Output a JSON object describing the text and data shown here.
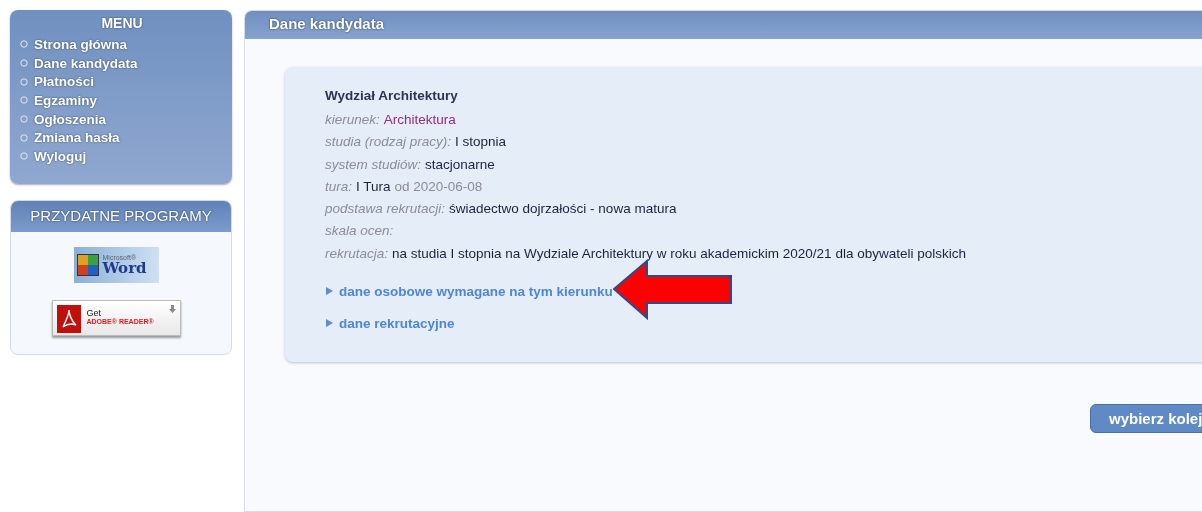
{
  "menu": {
    "title": "MENU",
    "items": [
      {
        "label": "Strona główna"
      },
      {
        "label": "Dane kandydata"
      },
      {
        "label": "Płatności"
      },
      {
        "label": "Egzaminy"
      },
      {
        "label": "Ogłoszenia"
      },
      {
        "label": "Zmiana hasła"
      },
      {
        "label": "Wyloguj"
      }
    ]
  },
  "programs": {
    "title": "PRZYDATNE PROGRAMY",
    "items": [
      {
        "kind": "word",
        "texts": [
          "Microsoft®",
          "Word"
        ]
      },
      {
        "kind": "adobe",
        "texts": [
          "Get",
          "ADOBE® READER®"
        ]
      }
    ]
  },
  "main": {
    "title": "Dane kandydata",
    "card": {
      "heading": "Wydział Architektury",
      "details": [
        {
          "label": "kierunek:",
          "value": "Architektura",
          "kind": "link"
        },
        {
          "label": "studia (rodzaj pracy):",
          "value": "I stopnia",
          "kind": "plain"
        },
        {
          "label": "system studiów:",
          "value": "stacjonarne",
          "kind": "plain"
        },
        {
          "label": "tura:",
          "value": "I Tura",
          "note": "od 2020-06-08",
          "kind": "plain"
        },
        {
          "label": "podstawa rekrutacji:",
          "value": "świadectwo dojrzałości - nowa matura",
          "kind": "plain"
        },
        {
          "label": "skala ocen:",
          "kind": "plain"
        },
        {
          "label": "rekrutacja:",
          "value": "na studia I stopnia na Wydziale Architektury w roku akademickim 2020/21 dla obywateli polskich",
          "kind": "plain"
        }
      ],
      "sections": [
        {
          "label": "dane osobowe wymagane na tym kierunku",
          "expanded": false,
          "annotated": true
        },
        {
          "label": "dane rekrutacyjne",
          "expanded": false,
          "annotated": false
        }
      ]
    },
    "button": "wybierz kolej"
  }
}
